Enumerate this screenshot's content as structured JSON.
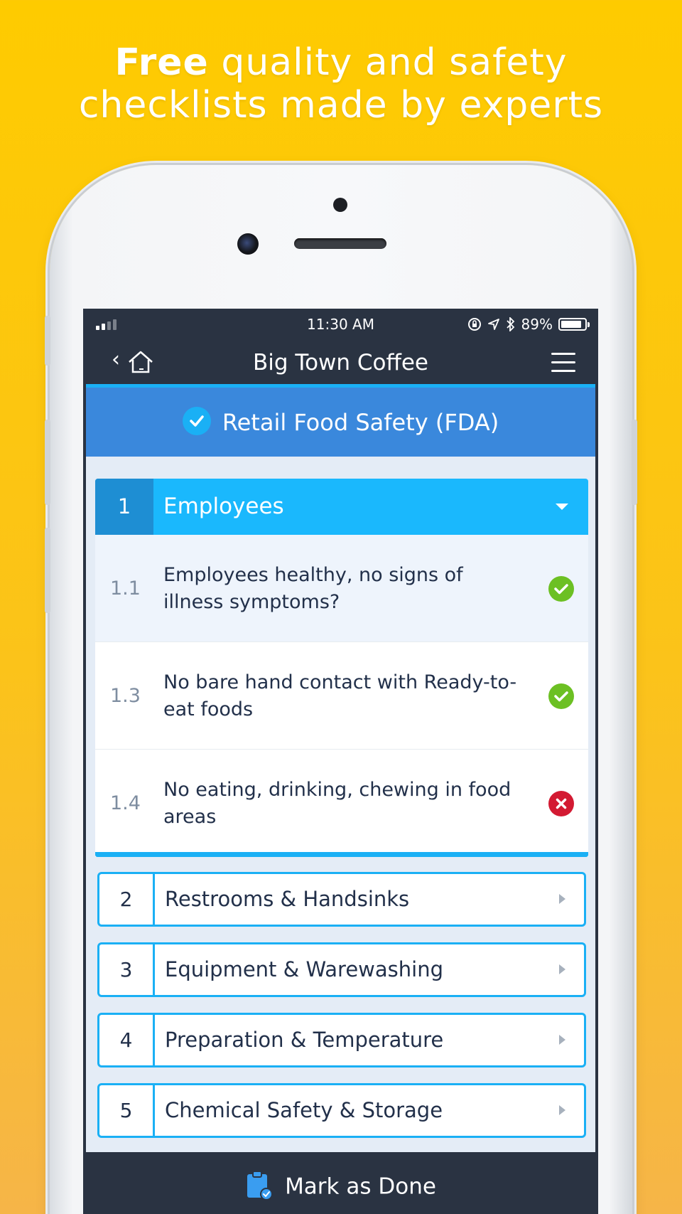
{
  "headline": {
    "bold": "Free",
    "line1_rest": " quality and safety",
    "line2": "checklists made by experts"
  },
  "statusbar": {
    "time": "11:30 AM",
    "battery_percent": "89%",
    "battery_level": 0.89
  },
  "navbar": {
    "back_glyph": "‹",
    "title": "Big Town Coffee"
  },
  "checklist": {
    "title": "Retail Food Safety (FDA)"
  },
  "open_section": {
    "number": "1",
    "title": "Employees",
    "items": [
      {
        "number": "1.1",
        "text": "Employees healthy, no signs of illness symptoms?",
        "status": "pass"
      },
      {
        "number": "1.3",
        "text": "No bare hand contact with Ready-to-eat foods",
        "status": "pass"
      },
      {
        "number": "1.4",
        "text": "No eating, drinking, chewing in food areas",
        "status": "fail"
      }
    ]
  },
  "sections": [
    {
      "number": "2",
      "title": "Restrooms & Handsinks"
    },
    {
      "number": "3",
      "title": "Equipment & Warewashing"
    },
    {
      "number": "4",
      "title": "Preparation & Temperature"
    },
    {
      "number": "5",
      "title": "Chemical Safety & Storage"
    }
  ],
  "footer": {
    "label": "Mark as Done"
  },
  "colors": {
    "background": "#fecb00",
    "nav": "#2a3342",
    "accent": "#1ab8fd",
    "header_blue": "#3a88dc",
    "pass": "#6cc023",
    "fail": "#d31a32"
  }
}
